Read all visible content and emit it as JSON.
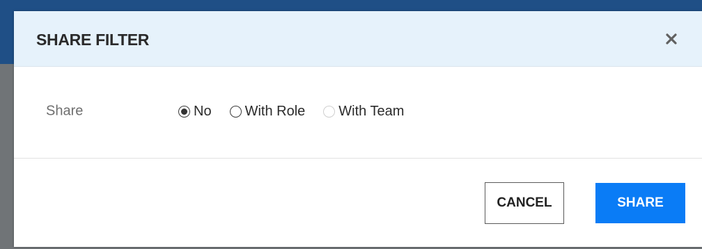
{
  "dialog": {
    "title": "SHARE FILTER",
    "close_icon": "close-icon"
  },
  "share_field": {
    "label": "Share",
    "options": [
      {
        "label": "No",
        "selected": true,
        "disabled": false
      },
      {
        "label": "With Role",
        "selected": false,
        "disabled": false
      },
      {
        "label": "With Team",
        "selected": false,
        "disabled": true
      }
    ]
  },
  "footer": {
    "cancel_label": "CANCEL",
    "share_label": "SHARE"
  },
  "colors": {
    "header_bg": "#e6f2fb",
    "primary": "#0a7cf6"
  }
}
